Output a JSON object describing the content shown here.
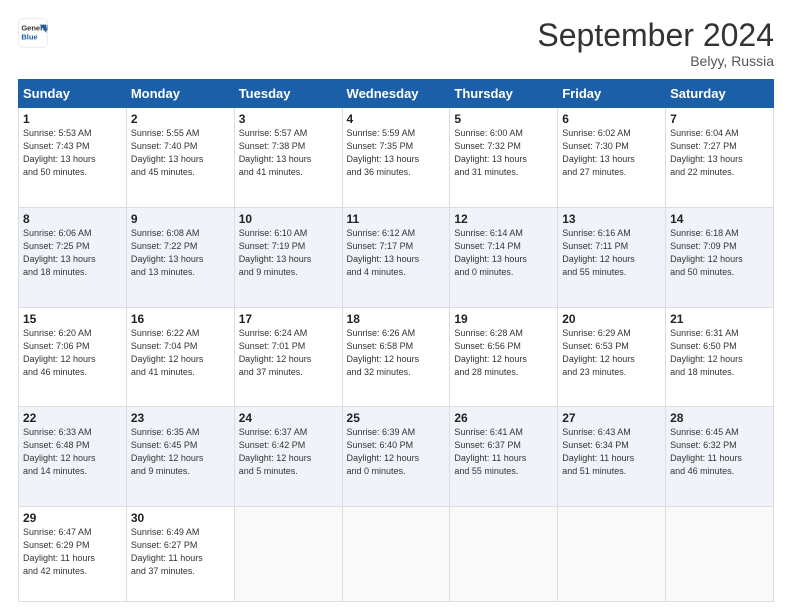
{
  "header": {
    "logo_line1": "General",
    "logo_line2": "Blue",
    "month": "September 2024",
    "location": "Belyy, Russia"
  },
  "weekdays": [
    "Sunday",
    "Monday",
    "Tuesday",
    "Wednesday",
    "Thursday",
    "Friday",
    "Saturday"
  ],
  "weeks": [
    [
      {
        "day": 1,
        "info": "Sunrise: 5:53 AM\nSunset: 7:43 PM\nDaylight: 13 hours\nand 50 minutes."
      },
      {
        "day": 2,
        "info": "Sunrise: 5:55 AM\nSunset: 7:40 PM\nDaylight: 13 hours\nand 45 minutes."
      },
      {
        "day": 3,
        "info": "Sunrise: 5:57 AM\nSunset: 7:38 PM\nDaylight: 13 hours\nand 41 minutes."
      },
      {
        "day": 4,
        "info": "Sunrise: 5:59 AM\nSunset: 7:35 PM\nDaylight: 13 hours\nand 36 minutes."
      },
      {
        "day": 5,
        "info": "Sunrise: 6:00 AM\nSunset: 7:32 PM\nDaylight: 13 hours\nand 31 minutes."
      },
      {
        "day": 6,
        "info": "Sunrise: 6:02 AM\nSunset: 7:30 PM\nDaylight: 13 hours\nand 27 minutes."
      },
      {
        "day": 7,
        "info": "Sunrise: 6:04 AM\nSunset: 7:27 PM\nDaylight: 13 hours\nand 22 minutes."
      }
    ],
    [
      {
        "day": 8,
        "info": "Sunrise: 6:06 AM\nSunset: 7:25 PM\nDaylight: 13 hours\nand 18 minutes."
      },
      {
        "day": 9,
        "info": "Sunrise: 6:08 AM\nSunset: 7:22 PM\nDaylight: 13 hours\nand 13 minutes."
      },
      {
        "day": 10,
        "info": "Sunrise: 6:10 AM\nSunset: 7:19 PM\nDaylight: 13 hours\nand 9 minutes."
      },
      {
        "day": 11,
        "info": "Sunrise: 6:12 AM\nSunset: 7:17 PM\nDaylight: 13 hours\nand 4 minutes."
      },
      {
        "day": 12,
        "info": "Sunrise: 6:14 AM\nSunset: 7:14 PM\nDaylight: 13 hours\nand 0 minutes."
      },
      {
        "day": 13,
        "info": "Sunrise: 6:16 AM\nSunset: 7:11 PM\nDaylight: 12 hours\nand 55 minutes."
      },
      {
        "day": 14,
        "info": "Sunrise: 6:18 AM\nSunset: 7:09 PM\nDaylight: 12 hours\nand 50 minutes."
      }
    ],
    [
      {
        "day": 15,
        "info": "Sunrise: 6:20 AM\nSunset: 7:06 PM\nDaylight: 12 hours\nand 46 minutes."
      },
      {
        "day": 16,
        "info": "Sunrise: 6:22 AM\nSunset: 7:04 PM\nDaylight: 12 hours\nand 41 minutes."
      },
      {
        "day": 17,
        "info": "Sunrise: 6:24 AM\nSunset: 7:01 PM\nDaylight: 12 hours\nand 37 minutes."
      },
      {
        "day": 18,
        "info": "Sunrise: 6:26 AM\nSunset: 6:58 PM\nDaylight: 12 hours\nand 32 minutes."
      },
      {
        "day": 19,
        "info": "Sunrise: 6:28 AM\nSunset: 6:56 PM\nDaylight: 12 hours\nand 28 minutes."
      },
      {
        "day": 20,
        "info": "Sunrise: 6:29 AM\nSunset: 6:53 PM\nDaylight: 12 hours\nand 23 minutes."
      },
      {
        "day": 21,
        "info": "Sunrise: 6:31 AM\nSunset: 6:50 PM\nDaylight: 12 hours\nand 18 minutes."
      }
    ],
    [
      {
        "day": 22,
        "info": "Sunrise: 6:33 AM\nSunset: 6:48 PM\nDaylight: 12 hours\nand 14 minutes."
      },
      {
        "day": 23,
        "info": "Sunrise: 6:35 AM\nSunset: 6:45 PM\nDaylight: 12 hours\nand 9 minutes."
      },
      {
        "day": 24,
        "info": "Sunrise: 6:37 AM\nSunset: 6:42 PM\nDaylight: 12 hours\nand 5 minutes."
      },
      {
        "day": 25,
        "info": "Sunrise: 6:39 AM\nSunset: 6:40 PM\nDaylight: 12 hours\nand 0 minutes."
      },
      {
        "day": 26,
        "info": "Sunrise: 6:41 AM\nSunset: 6:37 PM\nDaylight: 11 hours\nand 55 minutes."
      },
      {
        "day": 27,
        "info": "Sunrise: 6:43 AM\nSunset: 6:34 PM\nDaylight: 11 hours\nand 51 minutes."
      },
      {
        "day": 28,
        "info": "Sunrise: 6:45 AM\nSunset: 6:32 PM\nDaylight: 11 hours\nand 46 minutes."
      }
    ],
    [
      {
        "day": 29,
        "info": "Sunrise: 6:47 AM\nSunset: 6:29 PM\nDaylight: 11 hours\nand 42 minutes."
      },
      {
        "day": 30,
        "info": "Sunrise: 6:49 AM\nSunset: 6:27 PM\nDaylight: 11 hours\nand 37 minutes."
      },
      null,
      null,
      null,
      null,
      null
    ]
  ]
}
